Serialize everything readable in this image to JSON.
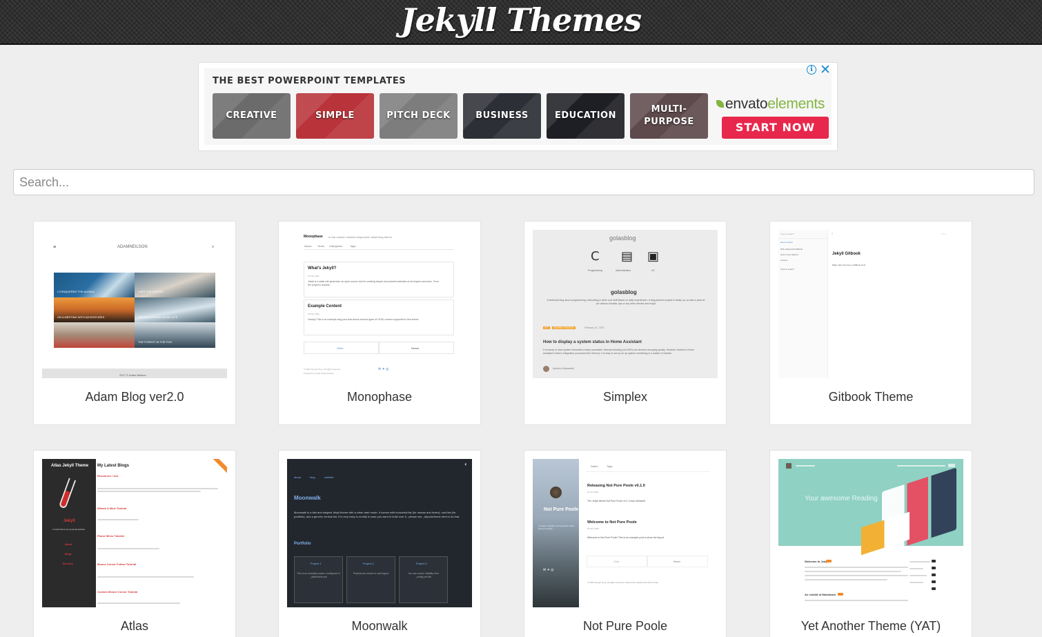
{
  "header": {
    "title": "Jekyll Themes"
  },
  "ad": {
    "heading": "THE BEST POWERPOINT TEMPLATES",
    "tiles": [
      {
        "label": "CREATIVE",
        "color": "#6b6b6b"
      },
      {
        "label": "SIMPLE",
        "color": "#b8343a"
      },
      {
        "label": "PITCH DECK",
        "color": "#7d7d7d"
      },
      {
        "label": "BUSINESS",
        "color": "#2c2f35"
      },
      {
        "label": "EDUCATION",
        "color": "#1e1f24"
      },
      {
        "label": "MULTI-\nPURPOSE",
        "color": "#5e4a4d"
      }
    ],
    "brand_main": "envato",
    "brand_accent": "elements",
    "cta": "START NOW",
    "info_icon": "info-icon",
    "close_icon": "close-icon"
  },
  "search": {
    "placeholder": "Search...",
    "value": ""
  },
  "themes": [
    {
      "name": "Adam Blog ver2.0",
      "preview": "adam"
    },
    {
      "name": "Monophase",
      "preview": "monophase"
    },
    {
      "name": "Simplex",
      "preview": "simplex"
    },
    {
      "name": "Gitbook Theme",
      "preview": "gitbook"
    },
    {
      "name": "Atlas",
      "preview": "atlas"
    },
    {
      "name": "Moonwalk",
      "preview": "moonwalk"
    },
    {
      "name": "Not Pure Poole",
      "preview": "notpurepoole"
    },
    {
      "name": "Yet Another Theme (YAT)",
      "preview": "yat"
    }
  ],
  "previews": {
    "adam": {
      "logo": "ADAMNEILSON",
      "captions": [
        "I CONQUERED THE ALASKA",
        "I MET THE SUNSET",
        "ON A MEETING WITH ADVENTURES",
        "SNOWBOARDING ON MY LIFE",
        "",
        "THE FOREST IN THE FOG"
      ],
      "footer": "2017 © Adam Neilson"
    },
    "monophase": {
      "title": "Monophase",
      "tagline": "A one-column minimal responsive Jekyll blog theme",
      "nav": [
        "About",
        "Years",
        "Categories",
        "Tags"
      ],
      "post1_title": "What's Jekyll?",
      "post1_date": "27 Feb 2021",
      "post1_text": "Jekyll is a static site generator, an open-source tool for creating simple yet powerful websites of all shapes and sizes. From the project's readme:",
      "post2_title": "Example Content",
      "post2_date": "18 Feb 2021",
      "post2_text": "Howdy! This is an example blog post that shows several types of HTML content supported in this theme.",
      "older": "Older",
      "newer": "Newer",
      "footer1": "© 2021 Songzi Vong. All rights reserved.",
      "footer2": "Powered by Jekyll & Monophase"
    },
    "simplex": {
      "brand": "golasblog",
      "cats": [
        "Programming",
        "Administration",
        "IoT"
      ],
      "site": "golasblog",
      "desc": "A technical blog about programming, networking & other cool stuff based on daily experiences. A blog planned project is finally up, so take a peek at our various tutorials, tips or any other articles and enjoy!",
      "tags": [
        "IOT",
        "ADMINISTRATION"
      ],
      "date": "February 01, 2021",
      "post_title": "How to display a system status in Home Assistant",
      "post_text": "It is handy to have system information easily accessible. Manual checking (via SSH) can become annoying quickly. However, thanks to Home Assistant's built-in integration (command line Sensor), it is easy to set up an up system monitoring in a matter of minutes.",
      "author": "Andrew Golasewski"
    },
    "gitbook": {
      "search": "Type to search",
      "items": [
        "about version",
        "Why Jekyll with GitBook",
        "How to Get Started",
        "License",
        "Type to search"
      ],
      "title": "Jekyll Gitbook",
      "text": "Make Jelly site have a GitBook look!"
    },
    "atlas": {
      "sidebar_title": "Atlas Jekyll Theme",
      "brand": "Jekyll",
      "tag": "A Jekyll theme for personal website",
      "links": [
        "About",
        "Blogs",
        "Rss feed"
      ],
      "heading": "My Latest Blogs",
      "posts": [
        "Resources I use",
        "Whack A Mole Tutorial",
        "Pause Menu Tutorial",
        "Mouse Cursor Follow Tutorial",
        "Custom Mouse Cursor Tutorial"
      ]
    },
    "moonwalk": {
      "nav": [
        "about",
        "blog",
        "website"
      ],
      "title": "Moonwalk",
      "desc": "Moonwalk is a fast and elegant Jekyll theme with a clean dark mode. It comes with horizontal list (for navbar and footer), card list (for portfolio), and a generic vertical list. It is very easy to modify in case you want to build over it - please see _layouts/home.html to do that.",
      "section": "Portfolio",
      "projects": [
        {
          "name": "Project 1",
          "text": "This is an example project, configured in _data/home.yml"
        },
        {
          "name": "Project 2",
          "text": "Projects are shown in card layout"
        },
        {
          "name": "Project 3",
          "text": "You can control visibility from _config.yml file"
        }
      ]
    },
    "notpurepoole": {
      "nav": [
        "Dates",
        "Tags"
      ],
      "sidebar_title": "Not Pure Poole",
      "sidebar_desc": "A simple, beautiful, and powerful Jekyll theme for blogs",
      "post1": "Releasing Not Pure Poole v0.1.0",
      "post1_date": "01 Oct 2020",
      "post1_text": "The Jekyll theme Not Pure Poole v0.1.0 was released!",
      "post2": "Welcome to Not Pure Poole",
      "post2_date": "29 Sep 2020",
      "post2_text": "Welcome to Not Pure Poole! This is an example post to show the layout.",
      "older": "Older",
      "newer": "Newer",
      "footer": "© 2020 Songzi Vong. All rights reserved. Powered by Jekyll & Not Pure Poole."
    },
    "yat": {
      "hero": "Your awesome Reading",
      "post1": "Welcome to Jekyll!",
      "post2": "An exhibit of Markdown"
    }
  },
  "colors": {
    "page_bg": "#eeeeee",
    "header_bg": "#2f2f2f",
    "cta": "#e8274c",
    "envato_green": "#82b541",
    "moonwalk_bg": "#22262d",
    "yat_teal": "#8fd1c3"
  }
}
